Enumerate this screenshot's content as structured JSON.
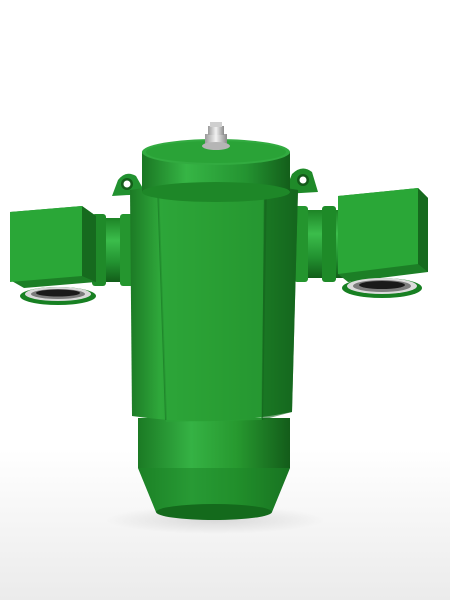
{
  "image": {
    "subject": "green-industrial-valve-body",
    "colors": {
      "background_top": "#ffffff",
      "background_bottom": "#ececec",
      "green_light": "#39b54a",
      "green_mid": "#22922e",
      "green_dark": "#14661d",
      "green_shadow": "#0d4a14",
      "metal_light": "#e9e9e9",
      "metal_dark": "#8a8a8a"
    }
  }
}
